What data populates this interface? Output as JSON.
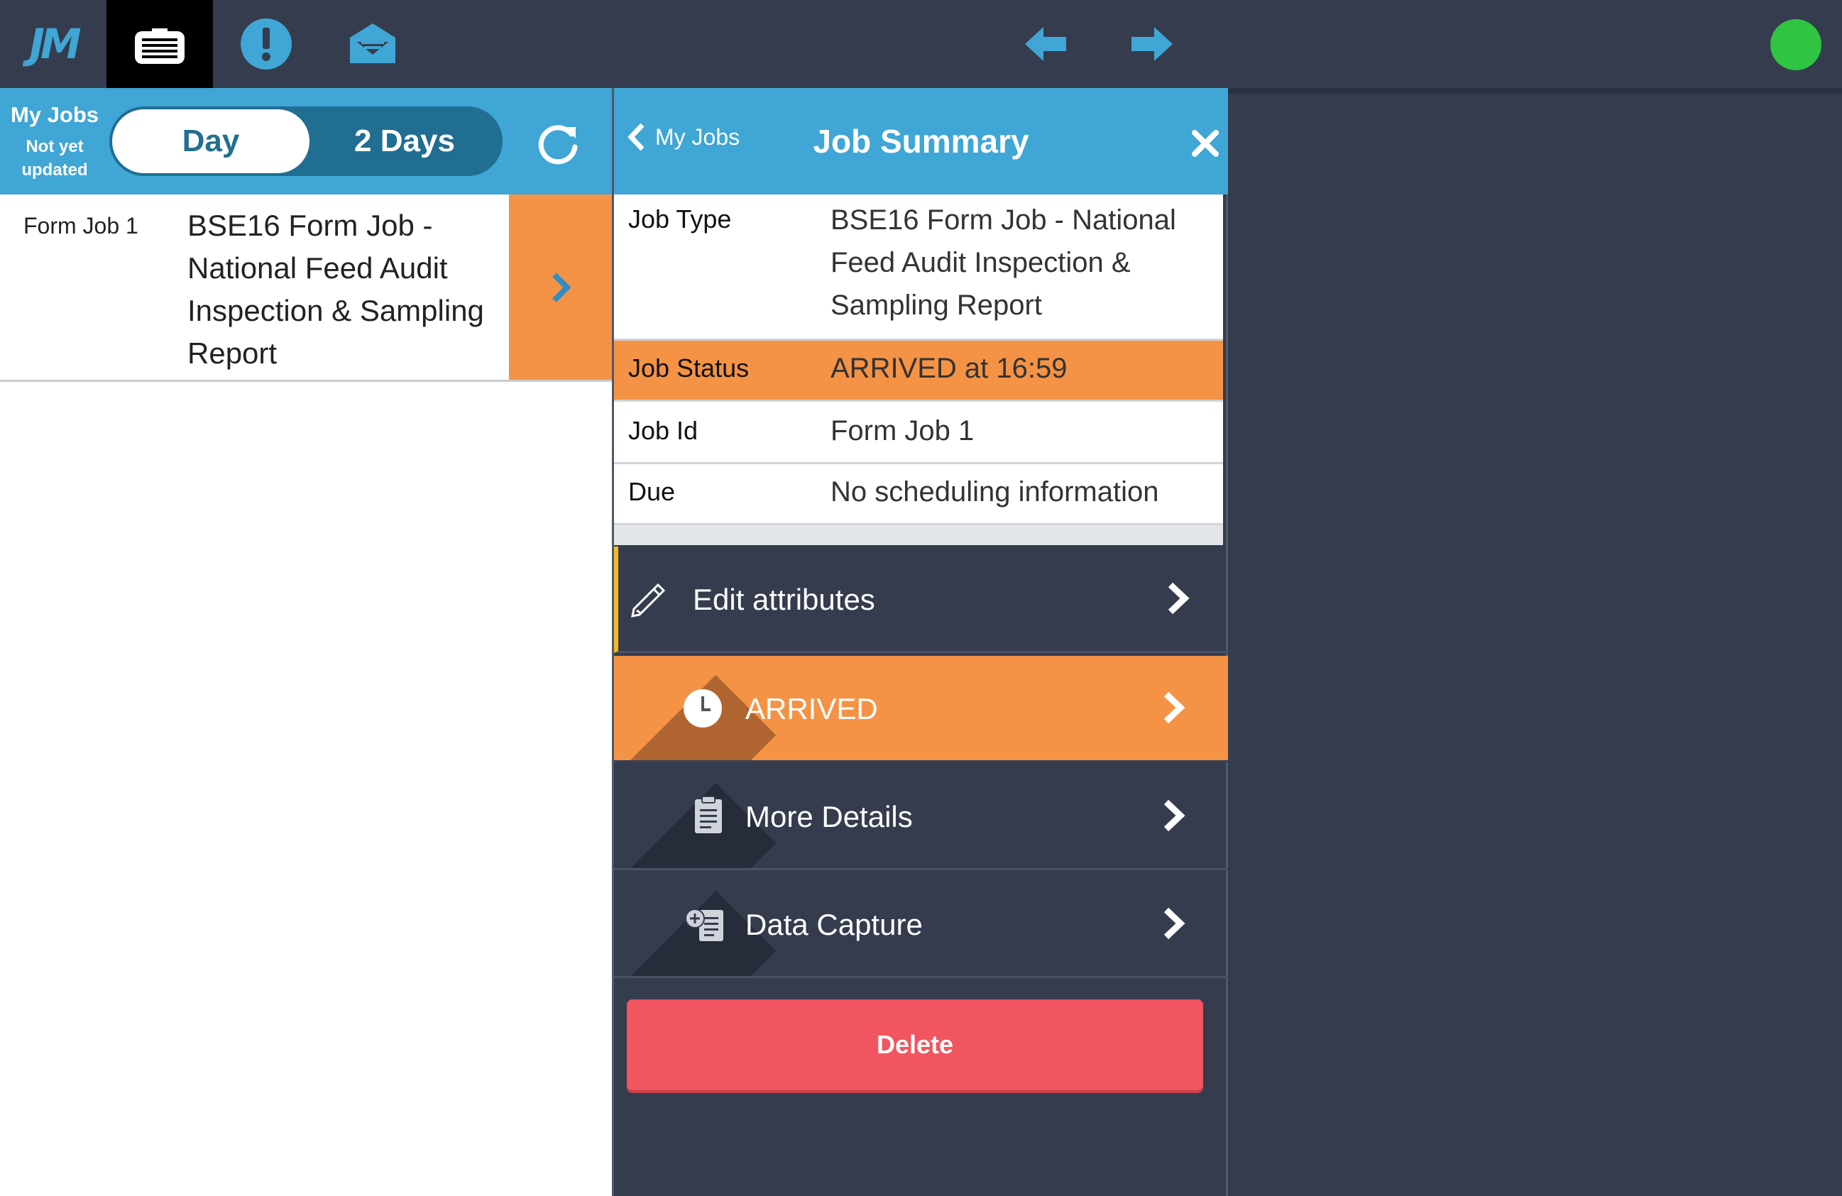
{
  "topbar": {
    "logo_text": "JM",
    "icons": [
      "app-logo",
      "jobs-briefcase-icon",
      "alert-icon",
      "inbox-icon",
      "back-arrow-icon",
      "forward-arrow-icon"
    ],
    "status_color": "#2fc441"
  },
  "jobs_panel": {
    "title": "My Jobs",
    "subtitle": "Not yet updated",
    "toggle": {
      "day_label": "Day",
      "two_days_label": "2 Days",
      "selected": "Day"
    },
    "jobs": [
      {
        "id": "Form Job 1",
        "name": "BSE16 Form Job - National Feed Audit Inspection & Sampling Report"
      }
    ]
  },
  "summary": {
    "back_label": "My Jobs",
    "title": "Job Summary",
    "rows": {
      "type": {
        "label": "Job Type",
        "value": "BSE16 Form Job - National Feed Audit Inspection & Sampling Report"
      },
      "status": {
        "label": "Job Status",
        "value": "ARRIVED at 16:59"
      },
      "id": {
        "label": "Job Id",
        "value": "Form Job 1"
      },
      "due": {
        "label": "Due",
        "value": "No scheduling information"
      }
    },
    "actions": {
      "edit": "Edit attributes",
      "arrived": "ARRIVED",
      "details": "More Details",
      "capture": "Data Capture"
    },
    "delete_label": "Delete"
  },
  "colors": {
    "accent_blue": "#3fa6d5",
    "orange": "#f49345",
    "dark_bg": "#353c4e",
    "delete_red": "#f05560",
    "edit_marker": "#f4b922"
  }
}
